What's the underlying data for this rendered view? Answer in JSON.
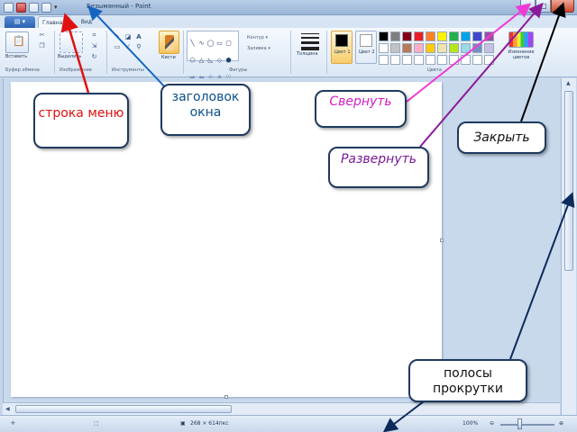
{
  "window": {
    "title": "Безымянный - Paint",
    "buttons": {
      "minimize": "–",
      "maximize": "□",
      "close": "✕"
    }
  },
  "ribbon": {
    "tabs": {
      "file": "▤ ▾",
      "home": "Главная",
      "view": "Вид"
    },
    "groups": {
      "clipboard": "Буфер обмена",
      "image": "Изображение",
      "tools": "Инструменты",
      "shapes": "Фигуры",
      "colors": "Цвета"
    },
    "buttons": {
      "paste": "Вставить",
      "select": "Выделить",
      "brushes": "Кисти",
      "outline": "Контур ▾",
      "fill": "Заливка ▾",
      "size": "Толщина",
      "color1": "Цвет 1",
      "color2": "Цвет 2",
      "edit_colors": "Изменение цветов"
    },
    "palette": [
      "#000000",
      "#7f7f7f",
      "#880015",
      "#ed1c24",
      "#ff7f27",
      "#fff200",
      "#22b14c",
      "#00a2e8",
      "#3f48cc",
      "#a349a4",
      "#ffffff",
      "#c3c3c3",
      "#b97a57",
      "#ffaec9",
      "#ffc90e",
      "#efe4b0",
      "#b5e61d",
      "#99d9ea",
      "#7092be",
      "#c8bfe7",
      "#ffffff",
      "#ffffff",
      "#ffffff",
      "#ffffff",
      "#ffffff",
      "#ffffff",
      "#ffffff",
      "#ffffff",
      "#ffffff",
      "#ffffff"
    ],
    "color1": "#000000",
    "color2": "#ffffff"
  },
  "status": {
    "dimensions": "268 × 614пкс",
    "zoom": "100%"
  },
  "callouts": {
    "menu_bar": "строка меню",
    "window_title": "заголовок окна",
    "minimize": "Свернуть",
    "maximize": "Развернуть",
    "close": "Закрыть",
    "scrollbars": "полосы прокрутки"
  },
  "colors": {
    "menu_arrow": "#e01010",
    "title_arrow": "#1565c0",
    "minimize_arrow": "#ee3bd6",
    "maximize_arrow": "#8b1a9a",
    "close_arrow": "#000000",
    "scroll_arrow": "#0d2a5c"
  }
}
